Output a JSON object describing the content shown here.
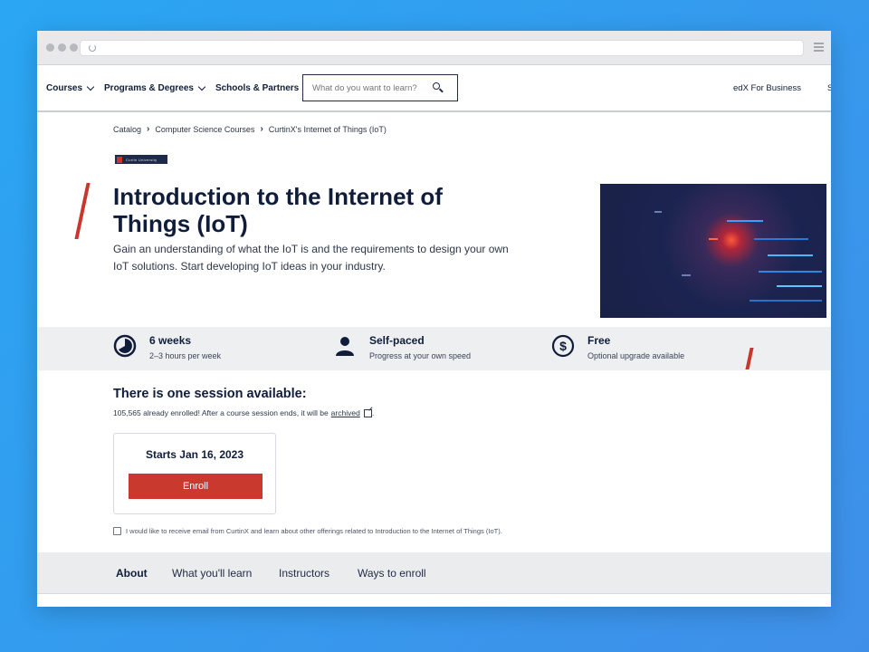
{
  "browser": {
    "url": ""
  },
  "nav": {
    "items": [
      {
        "label": "Courses"
      },
      {
        "label": "Programs & Degrees"
      },
      {
        "label": "Schools & Partners"
      }
    ],
    "search_placeholder": "What do you want to learn?",
    "business_link": "edX For Business",
    "edge_glyph": "S"
  },
  "breadcrumb": [
    "Catalog",
    "Computer Science Courses",
    "CurtinX's Internet of Things (IoT)"
  ],
  "logo_text": "Curtin University",
  "course": {
    "title": "Introduction to the Internet of Things (IoT)",
    "description": "Gain an understanding of what the IoT is and the requirements to design your own IoT solutions. Start developing IoT ideas in your industry."
  },
  "stats": [
    {
      "icon": "clock-icon",
      "title": "6 weeks",
      "sub": "2–3 hours per week"
    },
    {
      "icon": "person-icon",
      "title": "Self-paced",
      "sub": "Progress at your own speed"
    },
    {
      "icon": "dollar-icon",
      "title": "Free",
      "sub": "Optional upgrade available"
    }
  ],
  "session": {
    "heading": "There is one session available:",
    "enrolled_text": "105,565 already enrolled! After a course session ends, it will be",
    "archived_link": "archived",
    "enrolled_suffix": ".",
    "start_label": "Starts Jan 16, 2023",
    "enroll_label": "Enroll"
  },
  "optin_text": "I would like to receive email from CurtinX and learn about other offerings related to Introduction to the Internet of Things (IoT).",
  "tabs": [
    {
      "label": "About",
      "active": true
    },
    {
      "label": "What you'll learn",
      "active": false
    },
    {
      "label": "Instructors",
      "active": false
    },
    {
      "label": "Ways to enroll",
      "active": false
    }
  ],
  "colors": {
    "accent_red": "#c9392d",
    "navy_text": "#0f1d3a",
    "background_blue": "#2aa6f2"
  }
}
